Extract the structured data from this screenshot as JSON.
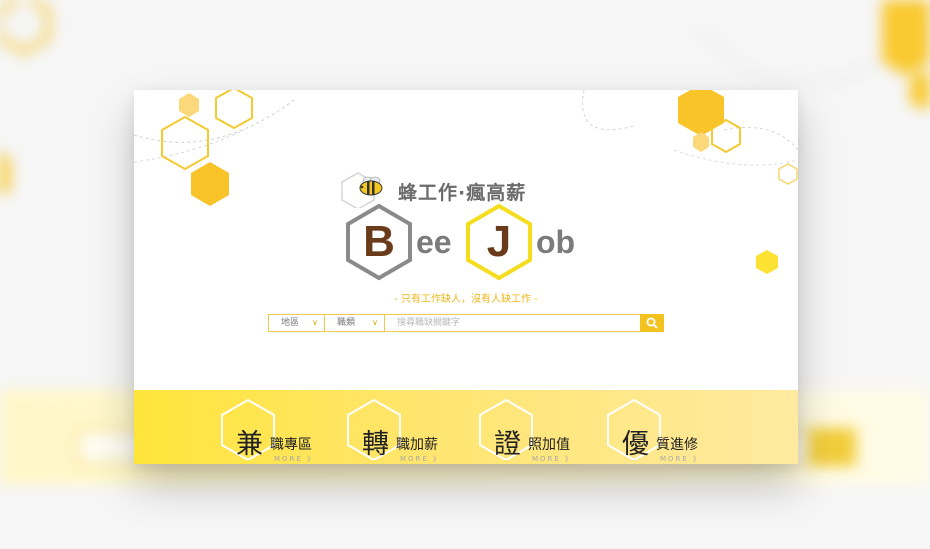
{
  "slogan": "蜂工作·瘋高薪",
  "logo": {
    "first_letter": "B",
    "first_rest": "ee",
    "second_letter": "J",
    "second_rest": "ob"
  },
  "tagline": "- 只有工作缺人，沒有人缺工作 -",
  "search": {
    "region_label": "地區",
    "category_label": "職類",
    "placeholder": "搜尋職缺關鍵字"
  },
  "features": [
    {
      "big": "兼",
      "small": "職專區",
      "more": "MORE 》"
    },
    {
      "big": "轉",
      "small": "職加薪",
      "more": "MORE 》"
    },
    {
      "big": "證",
      "small": "照加值",
      "more": "MORE 》"
    },
    {
      "big": "優",
      "small": "質進修",
      "more": "MORE 》"
    }
  ],
  "colors": {
    "accent": "#f3c21f",
    "brand_brown": "#6a3b1a",
    "logo_gray": "#7b7b7b",
    "band_start": "#ffe53a",
    "band_end": "#ffeaa0"
  },
  "icons": [
    "bee-icon",
    "search-icon",
    "chevron-down-icon",
    "hexagon-icon"
  ]
}
